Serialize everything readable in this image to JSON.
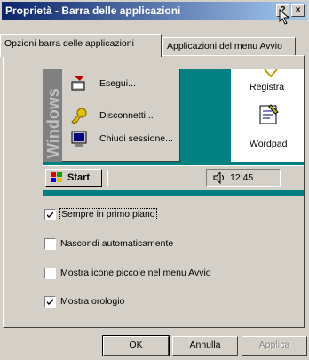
{
  "window": {
    "title": "Proprietà - Barra delle applicazioni",
    "help_button": "?",
    "close_button": "×"
  },
  "tabs": [
    {
      "label": "Opzioni barra delle applicazioni",
      "active": true
    },
    {
      "label": "Applicazioni del menu Avvio",
      "active": false
    }
  ],
  "preview": {
    "side_banner": "Windows",
    "menu_items": [
      {
        "label": "Esegui...",
        "icon": "run-icon"
      },
      {
        "label": "Disconnetti...",
        "icon": "logoff-key-icon"
      },
      {
        "label": "Chiudi sessione...",
        "icon": "shutdown-icon"
      }
    ],
    "desktop_icons": [
      {
        "label": "Registra",
        "icon": "recorder-icon"
      },
      {
        "label": "Wordpad",
        "icon": "wordpad-icon"
      }
    ],
    "start_button": "Start",
    "clock": "12:45"
  },
  "options": [
    {
      "label": "Sempre in primo piano",
      "checked": true
    },
    {
      "label": "Nascondi automaticamente",
      "checked": false
    },
    {
      "label": "Mostra icone piccole nel menu Avvio",
      "checked": false
    },
    {
      "label": "Mostra orologio",
      "checked": true
    }
  ],
  "buttons": {
    "ok": "OK",
    "cancel": "Annulla",
    "apply": "Applica"
  }
}
